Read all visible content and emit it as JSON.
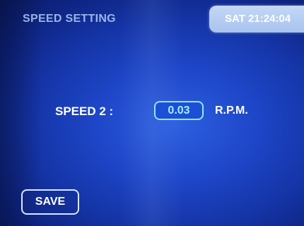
{
  "header": {
    "title": "SPEED SETTING",
    "datetime": "SAT 21:24:04"
  },
  "speed": {
    "label": "SPEED 2 :",
    "value": "0.03",
    "unit": "R.P.M."
  },
  "actions": {
    "save_label": "SAVE"
  },
  "colors": {
    "background": "#1e46c8",
    "header_tab": "#c4d8f6",
    "value_border": "#8ee8f4"
  }
}
